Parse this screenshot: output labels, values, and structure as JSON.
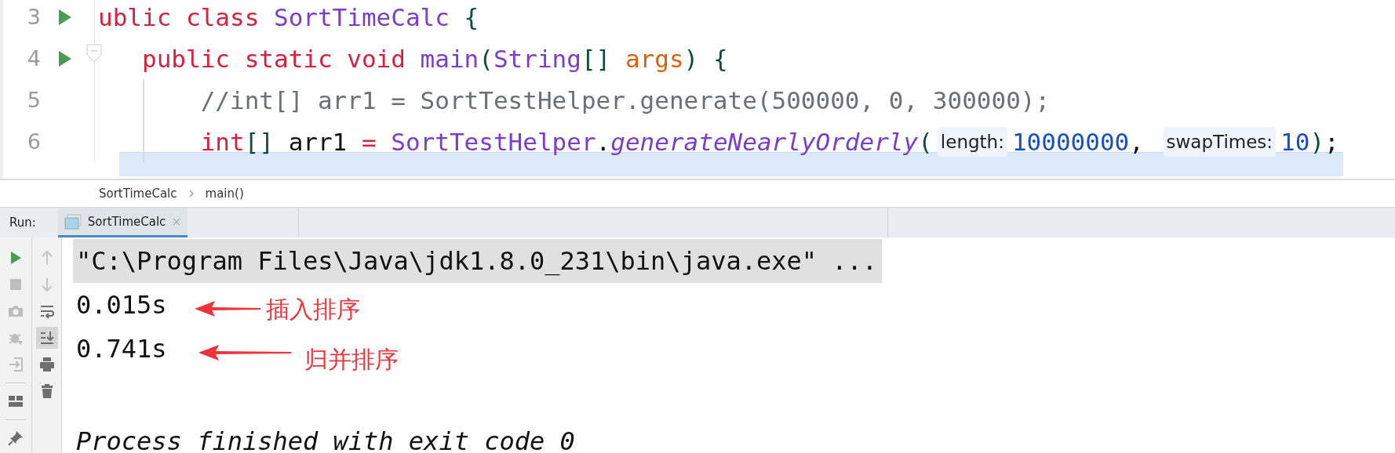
{
  "editor": {
    "lines": [
      {
        "number": "3",
        "run_marker": true,
        "fold_marker": false,
        "indent_guide": false,
        "tokens": [
          {
            "kind": "keyword",
            "text": "ublic class "
          },
          {
            "kind": "type",
            "text": "SortTimeCalc"
          },
          {
            "kind": "punct",
            "text": " {"
          }
        ]
      },
      {
        "number": "4",
        "run_marker": true,
        "fold_marker": true,
        "indent_guide": false,
        "tokens": [
          {
            "kind": "keyword",
            "text": "   public static void "
          },
          {
            "kind": "type",
            "text": "main"
          },
          {
            "kind": "punct",
            "text": "("
          },
          {
            "kind": "type",
            "text": "String"
          },
          {
            "kind": "punct",
            "text": "[] "
          },
          {
            "kind": "param",
            "text": "args"
          },
          {
            "kind": "punct",
            "text": ") {"
          }
        ]
      },
      {
        "number": "5",
        "run_marker": false,
        "fold_marker": false,
        "indent_guide": true,
        "tokens": [
          {
            "kind": "comment",
            "text": "       //int[] arr1 = SortTestHelper.generate(500000, 0, 300000);"
          }
        ]
      },
      {
        "number": "6",
        "run_marker": false,
        "fold_marker": false,
        "indent_guide": true,
        "tokens": [
          {
            "kind": "keyword",
            "text": "       int"
          },
          {
            "kind": "punct",
            "text": "[]"
          },
          {
            "kind": "plain",
            "text": " arr1 "
          },
          {
            "kind": "keyword",
            "text": "= "
          },
          {
            "kind": "type",
            "text": "SortTestHelper"
          },
          {
            "kind": "plain",
            "text": "."
          },
          {
            "kind": "method",
            "text": "generateNearlyOrderly"
          },
          {
            "kind": "punct",
            "text": "("
          },
          {
            "kind": "hint",
            "text": "length:"
          },
          {
            "kind": "number",
            "text": "10000000"
          },
          {
            "kind": "plain",
            "text": ", "
          },
          {
            "kind": "hint",
            "text": "swapTimes:"
          },
          {
            "kind": "number",
            "text": "10"
          },
          {
            "kind": "punct",
            "text": ")"
          },
          {
            "kind": "plain",
            "text": ";"
          }
        ]
      }
    ]
  },
  "breadcrumbs": [
    "SortTimeCalc",
    "main()"
  ],
  "run_panel": {
    "label": "Run:",
    "tabs": [
      {
        "label": "SortTimeCalc",
        "selected": true
      }
    ]
  },
  "console_tools": [
    {
      "kind": "run",
      "disabled": false
    },
    {
      "kind": "stop",
      "disabled": true
    },
    {
      "kind": "camera",
      "disabled": true
    },
    {
      "kind": "bug",
      "disabled": true
    },
    {
      "kind": "login",
      "disabled": true
    },
    {
      "kind": "layout",
      "disabled": false
    },
    {
      "kind": "pin",
      "disabled": false
    }
  ],
  "console_tools_2": [
    {
      "kind": "up",
      "on": false,
      "disabled": true
    },
    {
      "kind": "down",
      "on": false,
      "disabled": true
    },
    {
      "kind": "wrap",
      "on": false,
      "disabled": false
    },
    {
      "kind": "scroll-end",
      "on": true,
      "disabled": false
    },
    {
      "kind": "print",
      "on": false,
      "disabled": false
    },
    {
      "kind": "trash",
      "on": false,
      "disabled": false
    }
  ],
  "console": [
    {
      "kind": "command",
      "text": "\"C:\\Program Files\\Java\\jdk1.8.0_231\\bin\\java.exe\" ..."
    },
    {
      "kind": "output",
      "text": "0.015s"
    },
    {
      "kind": "output",
      "text": "0.741s"
    },
    {
      "kind": "exit",
      "text": "Process finished with exit code 0"
    }
  ],
  "annotations": [
    {
      "text": "插入排序"
    },
    {
      "text": "归并排序"
    }
  ]
}
